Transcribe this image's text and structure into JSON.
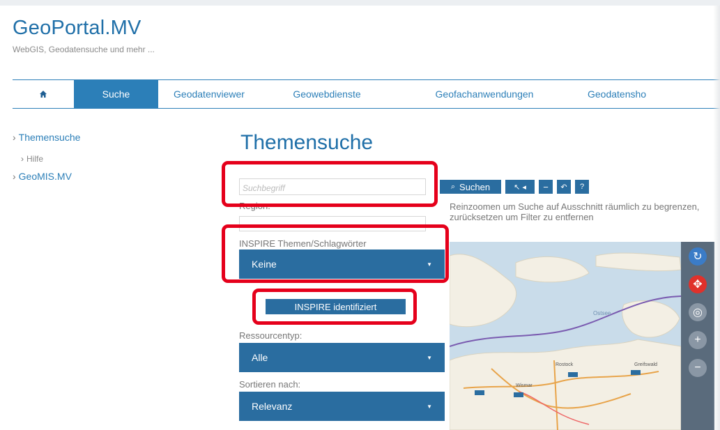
{
  "site": {
    "title": "GeoPortal.MV",
    "subtitle": "WebGIS, Geodatensuche und mehr ..."
  },
  "nav": {
    "home_icon": "home-icon",
    "items": [
      "Suche",
      "Geodatenviewer",
      "Geowebdienste",
      "Geofachanwendungen",
      "Geodatensho"
    ]
  },
  "sidebar": {
    "items": [
      {
        "label": "Themensuche"
      },
      {
        "label": "Hilfe"
      },
      {
        "label": "GeoMIS.MV"
      }
    ]
  },
  "main": {
    "title": "Themensuche",
    "search_placeholder": "Suchbegriff",
    "region_label": "Region:",
    "region_value": "",
    "inspire_label": "INSPIRE Themen/Schlagwörter",
    "inspire_value": "Keine",
    "inspire_button": "INSPIRE identifiziert",
    "ressource_label": "Ressourcentyp:",
    "ressource_value": "Alle",
    "sort_label": "Sortieren nach:",
    "sort_value": "Relevanz"
  },
  "toolbar": {
    "search_label": "Suchen",
    "help_label": "?",
    "help_text": "Reinzoomen um Suche auf Ausschnitt räumlich zu begrenzen, zurücksetzen um Filter zu entfernen"
  },
  "map": {
    "labels": [
      "Ostsee",
      "Rostock",
      "Wismar",
      "Greifswald"
    ],
    "colors": {
      "sea": "#c9dcea",
      "land": "#f3efe4",
      "accent": "#2a6da0",
      "highlight": "#e5001b"
    }
  }
}
